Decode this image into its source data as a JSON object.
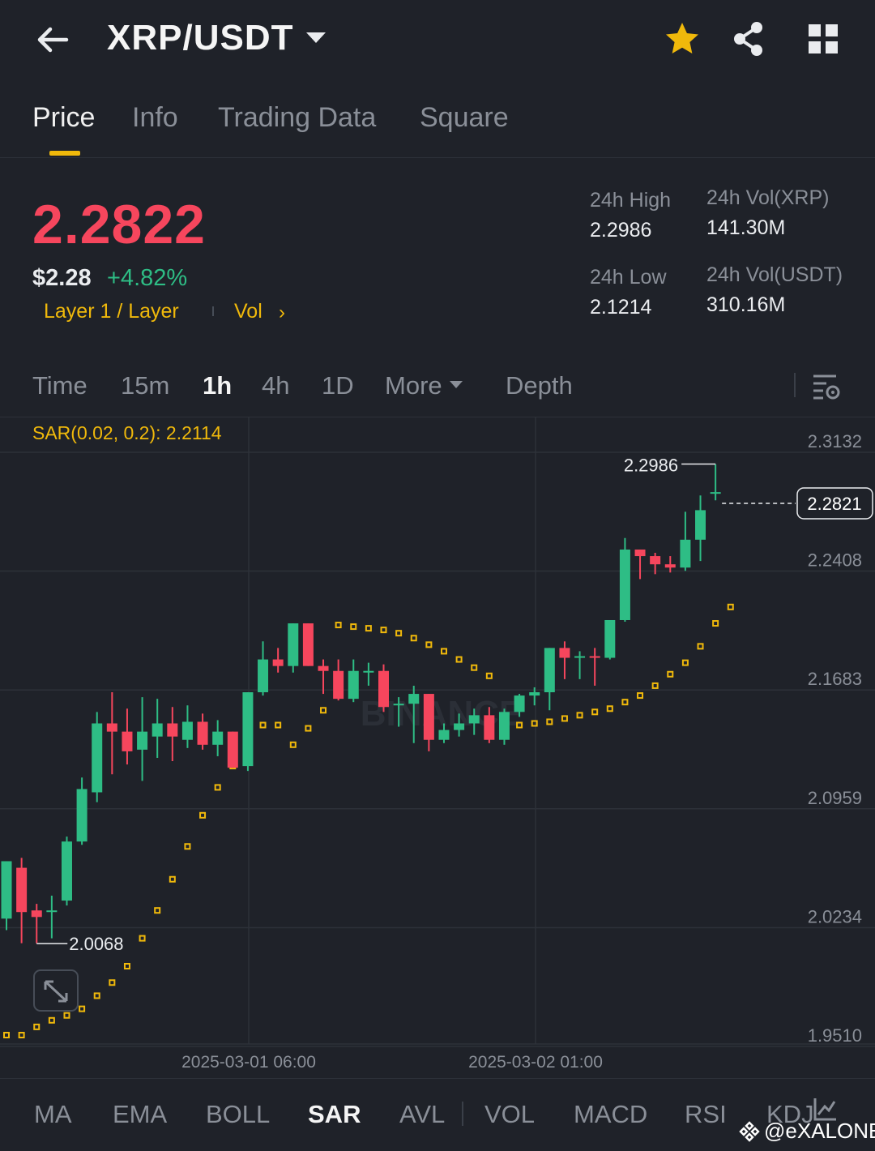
{
  "header": {
    "pair": "XRP/USDT",
    "icons": [
      "back-arrow-icon",
      "caret-down-icon",
      "star-icon",
      "share-icon",
      "grid-menu-icon"
    ],
    "star_color": "#f0b90b"
  },
  "tabs": [
    {
      "label": "Price",
      "active": true
    },
    {
      "label": "Info",
      "active": false
    },
    {
      "label": "Trading Data",
      "active": false
    },
    {
      "label": "Square",
      "active": false
    }
  ],
  "ticker": {
    "last_price": "2.2822",
    "usd_price": "$2.28",
    "change_pct": "+4.82%",
    "tag": "Layer 1 / Layer",
    "vol_link": "Vol",
    "chevron": "›",
    "stats": {
      "high_label": "24h High",
      "high_value": "2.2986",
      "low_label": "24h Low",
      "low_value": "2.1214",
      "vol_base_label": "24h Vol(XRP)",
      "vol_base_value": "141.30M",
      "vol_quote_label": "24h Vol(USDT)",
      "vol_quote_value": "310.16M"
    },
    "colors": {
      "down": "#f6465d",
      "up": "#2ebd85",
      "accent": "#f0b90b"
    }
  },
  "timeframes": [
    {
      "label": "Time",
      "active": false
    },
    {
      "label": "15m",
      "active": false
    },
    {
      "label": "1h",
      "active": true
    },
    {
      "label": "4h",
      "active": false
    },
    {
      "label": "1D",
      "active": false
    },
    {
      "label": "More",
      "active": false
    },
    {
      "label": "Depth",
      "active": false
    }
  ],
  "chart": {
    "indicator_label": "SAR(0.02, 0.2): 2.2114",
    "watermark": "BINANCE",
    "high_marker": "2.2986",
    "low_marker": "2.0068",
    "current_price_tag": "2.2821",
    "time_labels": [
      "2025-03-01 06:00",
      "2025-03-02 01:00"
    ],
    "price_axis": [
      "2.3132",
      "2.2408",
      "2.1683",
      "2.0959",
      "2.0234",
      "1.9510"
    ]
  },
  "chart_data": {
    "type": "candlestick",
    "interval": "1h",
    "y_range": [
      1.951,
      2.3132
    ],
    "y_ticks": [
      2.3132,
      2.2408,
      2.1683,
      2.0959,
      2.0234,
      1.951
    ],
    "x_labels": [
      "2025-03-01 06:00",
      "2025-03-02 01:00"
    ],
    "candles": [
      {
        "o": 2.022,
        "h": 2.048,
        "l": 2.015,
        "c": 2.057
      },
      {
        "o": 2.053,
        "h": 2.059,
        "l": 2.007,
        "c": 2.026
      },
      {
        "o": 2.027,
        "h": 2.031,
        "l": 2.007,
        "c": 2.023
      },
      {
        "o": 2.026,
        "h": 2.036,
        "l": 2.01,
        "c": 2.027
      },
      {
        "o": 2.033,
        "h": 2.072,
        "l": 2.03,
        "c": 2.069
      },
      {
        "o": 2.069,
        "h": 2.108,
        "l": 2.067,
        "c": 2.101
      },
      {
        "o": 2.099,
        "h": 2.148,
        "l": 2.093,
        "c": 2.141
      },
      {
        "o": 2.141,
        "h": 2.16,
        "l": 2.11,
        "c": 2.136
      },
      {
        "o": 2.136,
        "h": 2.15,
        "l": 2.116,
        "c": 2.124
      },
      {
        "o": 2.125,
        "h": 2.157,
        "l": 2.106,
        "c": 2.136
      },
      {
        "o": 2.133,
        "h": 2.156,
        "l": 2.12,
        "c": 2.141
      },
      {
        "o": 2.141,
        "h": 2.151,
        "l": 2.118,
        "c": 2.133
      },
      {
        "o": 2.131,
        "h": 2.152,
        "l": 2.126,
        "c": 2.142
      },
      {
        "o": 2.142,
        "h": 2.147,
        "l": 2.125,
        "c": 2.128
      },
      {
        "o": 2.128,
        "h": 2.143,
        "l": 2.121,
        "c": 2.136
      },
      {
        "o": 2.136,
        "h": 2.136,
        "l": 2.115,
        "c": 2.114
      },
      {
        "o": 2.115,
        "h": 2.16,
        "l": 2.112,
        "c": 2.16
      },
      {
        "o": 2.16,
        "h": 2.191,
        "l": 2.158,
        "c": 2.18
      },
      {
        "o": 2.18,
        "h": 2.187,
        "l": 2.172,
        "c": 2.176
      },
      {
        "o": 2.176,
        "h": 2.198,
        "l": 2.172,
        "c": 2.202
      },
      {
        "o": 2.202,
        "h": 2.198,
        "l": 2.177,
        "c": 2.176
      },
      {
        "o": 2.176,
        "h": 2.18,
        "l": 2.159,
        "c": 2.173
      },
      {
        "o": 2.173,
        "h": 2.18,
        "l": 2.155,
        "c": 2.156
      },
      {
        "o": 2.156,
        "h": 2.18,
        "l": 2.154,
        "c": 2.173
      },
      {
        "o": 2.173,
        "h": 2.178,
        "l": 2.164,
        "c": 2.173
      },
      {
        "o": 2.173,
        "h": 2.177,
        "l": 2.148,
        "c": 2.151
      },
      {
        "o": 2.152,
        "h": 2.157,
        "l": 2.139,
        "c": 2.153
      },
      {
        "o": 2.153,
        "h": 2.164,
        "l": 2.129,
        "c": 2.159
      },
      {
        "o": 2.159,
        "h": 2.154,
        "l": 2.124,
        "c": 2.131
      },
      {
        "o": 2.131,
        "h": 2.141,
        "l": 2.129,
        "c": 2.137
      },
      {
        "o": 2.137,
        "h": 2.147,
        "l": 2.133,
        "c": 2.141
      },
      {
        "o": 2.141,
        "h": 2.15,
        "l": 2.134,
        "c": 2.146
      },
      {
        "o": 2.146,
        "h": 2.151,
        "l": 2.129,
        "c": 2.131
      },
      {
        "o": 2.131,
        "h": 2.15,
        "l": 2.128,
        "c": 2.148
      },
      {
        "o": 2.148,
        "h": 2.159,
        "l": 2.145,
        "c": 2.158
      },
      {
        "o": 2.158,
        "h": 2.163,
        "l": 2.152,
        "c": 2.16
      },
      {
        "o": 2.16,
        "h": 2.186,
        "l": 2.149,
        "c": 2.187
      },
      {
        "o": 2.187,
        "h": 2.191,
        "l": 2.168,
        "c": 2.181
      },
      {
        "o": 2.181,
        "h": 2.185,
        "l": 2.168,
        "c": 2.182
      },
      {
        "o": 2.182,
        "h": 2.187,
        "l": 2.164,
        "c": 2.181
      },
      {
        "o": 2.181,
        "h": 2.194,
        "l": 2.18,
        "c": 2.204
      },
      {
        "o": 2.204,
        "h": 2.254,
        "l": 2.203,
        "c": 2.247
      },
      {
        "o": 2.247,
        "h": 2.241,
        "l": 2.229,
        "c": 2.243
      },
      {
        "o": 2.243,
        "h": 2.245,
        "l": 2.232,
        "c": 2.238
      },
      {
        "o": 2.238,
        "h": 2.243,
        "l": 2.233,
        "c": 2.236
      },
      {
        "o": 2.236,
        "h": 2.27,
        "l": 2.234,
        "c": 2.253
      },
      {
        "o": 2.253,
        "h": 2.28,
        "l": 2.24,
        "c": 2.271
      },
      {
        "o": 2.281,
        "h": 2.299,
        "l": 2.277,
        "c": 2.282
      }
    ],
    "sar": [
      1.951,
      1.951,
      1.956,
      1.96,
      1.963,
      1.967,
      1.975,
      1.983,
      1.993,
      2.01,
      2.027,
      2.046,
      2.066,
      2.085,
      2.102,
      2.115,
      2.125,
      2.14,
      2.14,
      2.128,
      2.138,
      2.149,
      2.201,
      2.2,
      2.199,
      2.198,
      2.196,
      2.193,
      2.189,
      2.185,
      2.18,
      2.175,
      2.17,
      2.14,
      2.14,
      2.141,
      2.142,
      2.144,
      2.146,
      2.148,
      2.15,
      2.154,
      2.158,
      2.164,
      2.171,
      2.178,
      2.188,
      2.202,
      2.212
    ],
    "up_color": "#2ebd85",
    "down_color": "#f6465d",
    "sar_color": "#f0b90b"
  },
  "indicators": [
    {
      "label": "MA",
      "active": false
    },
    {
      "label": "EMA",
      "active": false
    },
    {
      "label": "BOLL",
      "active": false
    },
    {
      "label": "SAR",
      "active": true
    },
    {
      "label": "AVL",
      "active": false
    },
    {
      "label": "VOL",
      "active": false
    },
    {
      "label": "MACD",
      "active": false
    },
    {
      "label": "RSI",
      "active": false
    },
    {
      "label": "KDJ",
      "active": false
    }
  ],
  "watermark_user": "@eXALONE"
}
